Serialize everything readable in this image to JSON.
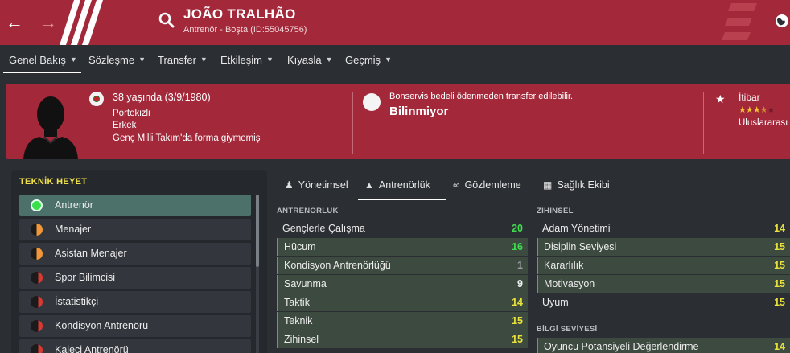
{
  "header": {
    "title": "JOÃO TRALHÃO",
    "subtitle": "Antrenör - Boşta (ID:55045756)",
    "back_icon": "arrow-left-icon",
    "forward_icon": "arrow-right-icon",
    "search_icon": "search-icon",
    "globe_icon": "globe-icon"
  },
  "tabs": [
    {
      "label": "Genel Bakış"
    },
    {
      "label": "Sözleşme"
    },
    {
      "label": "Transfer"
    },
    {
      "label": "Etkileşim"
    },
    {
      "label": "Kıyasla"
    },
    {
      "label": "Geçmiş"
    }
  ],
  "profile": {
    "age_line": "38 yaşında (3/9/1980)",
    "nationality": "Portekizli",
    "gender": "Erkek",
    "caps_note": "Genç Milli Takım'da forma giymemiş",
    "transfer_note": "Bonservis bedeli ödenmeden transfer edilebilir.",
    "transfer_value": "Bilinmiyor",
    "reputation_label": "İtibar",
    "reputation_stars": 3.5,
    "reputation_scope": "Uluslararası"
  },
  "staff": {
    "heading": "TEKNİK HEYET",
    "items": [
      {
        "label": "Antrenör",
        "selected": true
      },
      {
        "label": "Menajer"
      },
      {
        "label": "Asistan Menajer"
      },
      {
        "label": "Spor Bilimcisi"
      },
      {
        "label": "İstatistikçi"
      },
      {
        "label": "Kondisyon Antrenörü"
      },
      {
        "label": "Kaleci Antrenörü"
      }
    ]
  },
  "subtabs": [
    {
      "label": "Yönetimsel",
      "icon": "management-icon"
    },
    {
      "label": "Antrenörlük",
      "icon": "cones-icon"
    },
    {
      "label": "Gözlemleme",
      "icon": "binoculars-icon"
    },
    {
      "label": "Sağlık Ekibi",
      "icon": "medical-kit-icon"
    }
  ],
  "coaching": {
    "heading": "ANTRENÖRLÜK",
    "rows": [
      {
        "name": "Gençlerle Çalışma",
        "value": "20"
      },
      {
        "name": "Hücum",
        "value": "16"
      },
      {
        "name": "Kondisyon Antrenörlüğü",
        "value": "1"
      },
      {
        "name": "Savunma",
        "value": "9"
      },
      {
        "name": "Taktik",
        "value": "14"
      },
      {
        "name": "Teknik",
        "value": "15"
      },
      {
        "name": "Zihinsel",
        "value": "15"
      }
    ]
  },
  "mental": {
    "heading": "ZİHİNSEL",
    "rows": [
      {
        "name": "Adam Yönetimi",
        "value": "14"
      },
      {
        "name": "Disiplin Seviyesi",
        "value": "15"
      },
      {
        "name": "Kararlılık",
        "value": "15"
      },
      {
        "name": "Motivasyon",
        "value": "15"
      },
      {
        "name": "Uyum",
        "value": "15"
      }
    ]
  },
  "knowledge": {
    "heading": "BİLGİ SEVİYESİ",
    "rows": [
      {
        "name": "Oyuncu Potansiyeli Değerlendirme",
        "value": "14"
      }
    ]
  },
  "colors": {
    "accent": "#a3283a",
    "background": "#2b2e33",
    "value_high": "#3fdc4f",
    "value_good": "#e9e23a",
    "value_low": "#9a9da1"
  }
}
